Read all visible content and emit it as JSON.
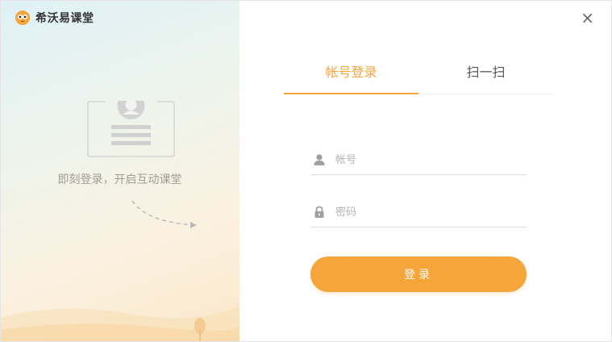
{
  "app": {
    "name": "希沃易课堂"
  },
  "left_panel": {
    "tagline": "即刻登录，开启互动课堂"
  },
  "window_controls": {
    "close_symbol": "×"
  },
  "tabs": [
    {
      "label": "帐号登录",
      "active": true
    },
    {
      "label": "扫一扫",
      "active": false
    }
  ],
  "form": {
    "account": {
      "placeholder": "帐号",
      "value": "",
      "icon": "user-icon"
    },
    "password": {
      "placeholder": "密码",
      "value": "",
      "icon": "lock-icon"
    },
    "submit_label": "登录"
  },
  "colors": {
    "accent": "#f5a53a",
    "tagline": "#a29c93",
    "placeholder": "#b4b4b4"
  }
}
